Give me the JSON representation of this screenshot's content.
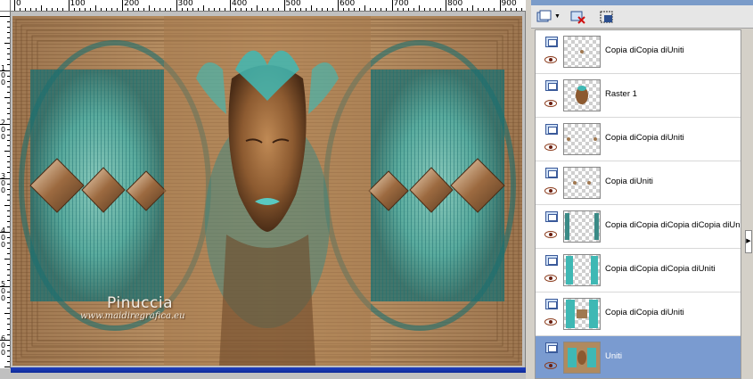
{
  "canvas": {
    "ruler_top_labels": [
      "0",
      "100",
      "200",
      "300",
      "400",
      "500",
      "600",
      "700",
      "800",
      "900"
    ],
    "ruler_left_labels": [
      "1\n0\n0",
      "2\n0\n0",
      "3\n0\n0",
      "4\n0\n0",
      "5\n0\n0",
      "6\n0\n0"
    ],
    "signature": "Pinuccia",
    "signature_url": "www.maidiregrafica.eu",
    "colors": {
      "teal": "#3fb8b4",
      "bronze": "#b08a5e",
      "dark_bronze": "#6e4a2a",
      "selection_bar": "#1f3fbf"
    }
  },
  "layers_panel": {
    "toolbar": {
      "new_layer_icon": "new-layer-icon",
      "delete_layer_icon": "delete-layer-icon",
      "mask_icon": "mask-icon"
    },
    "layers": [
      {
        "name": "Copia diCopia diUniti",
        "thumb": "dots",
        "selected": false
      },
      {
        "name": "Raster 1",
        "thumb": "face",
        "selected": false
      },
      {
        "name": "Copia diCopia diUniti",
        "thumb": "side-dots",
        "selected": false
      },
      {
        "name": "Copia diUniti",
        "thumb": "dots2",
        "selected": false
      },
      {
        "name": "Copia diCopia diCopia diCopia diUniti",
        "thumb": "frames",
        "selected": false
      },
      {
        "name": "Copia diCopia diCopia diUniti",
        "thumb": "teal-pillars",
        "selected": false
      },
      {
        "name": "Copia diCopia diUniti",
        "thumb": "teal-pillars2",
        "selected": false
      },
      {
        "name": "Uniti",
        "thumb": "full",
        "selected": true
      }
    ],
    "selected_color": "#7a9bd0"
  }
}
